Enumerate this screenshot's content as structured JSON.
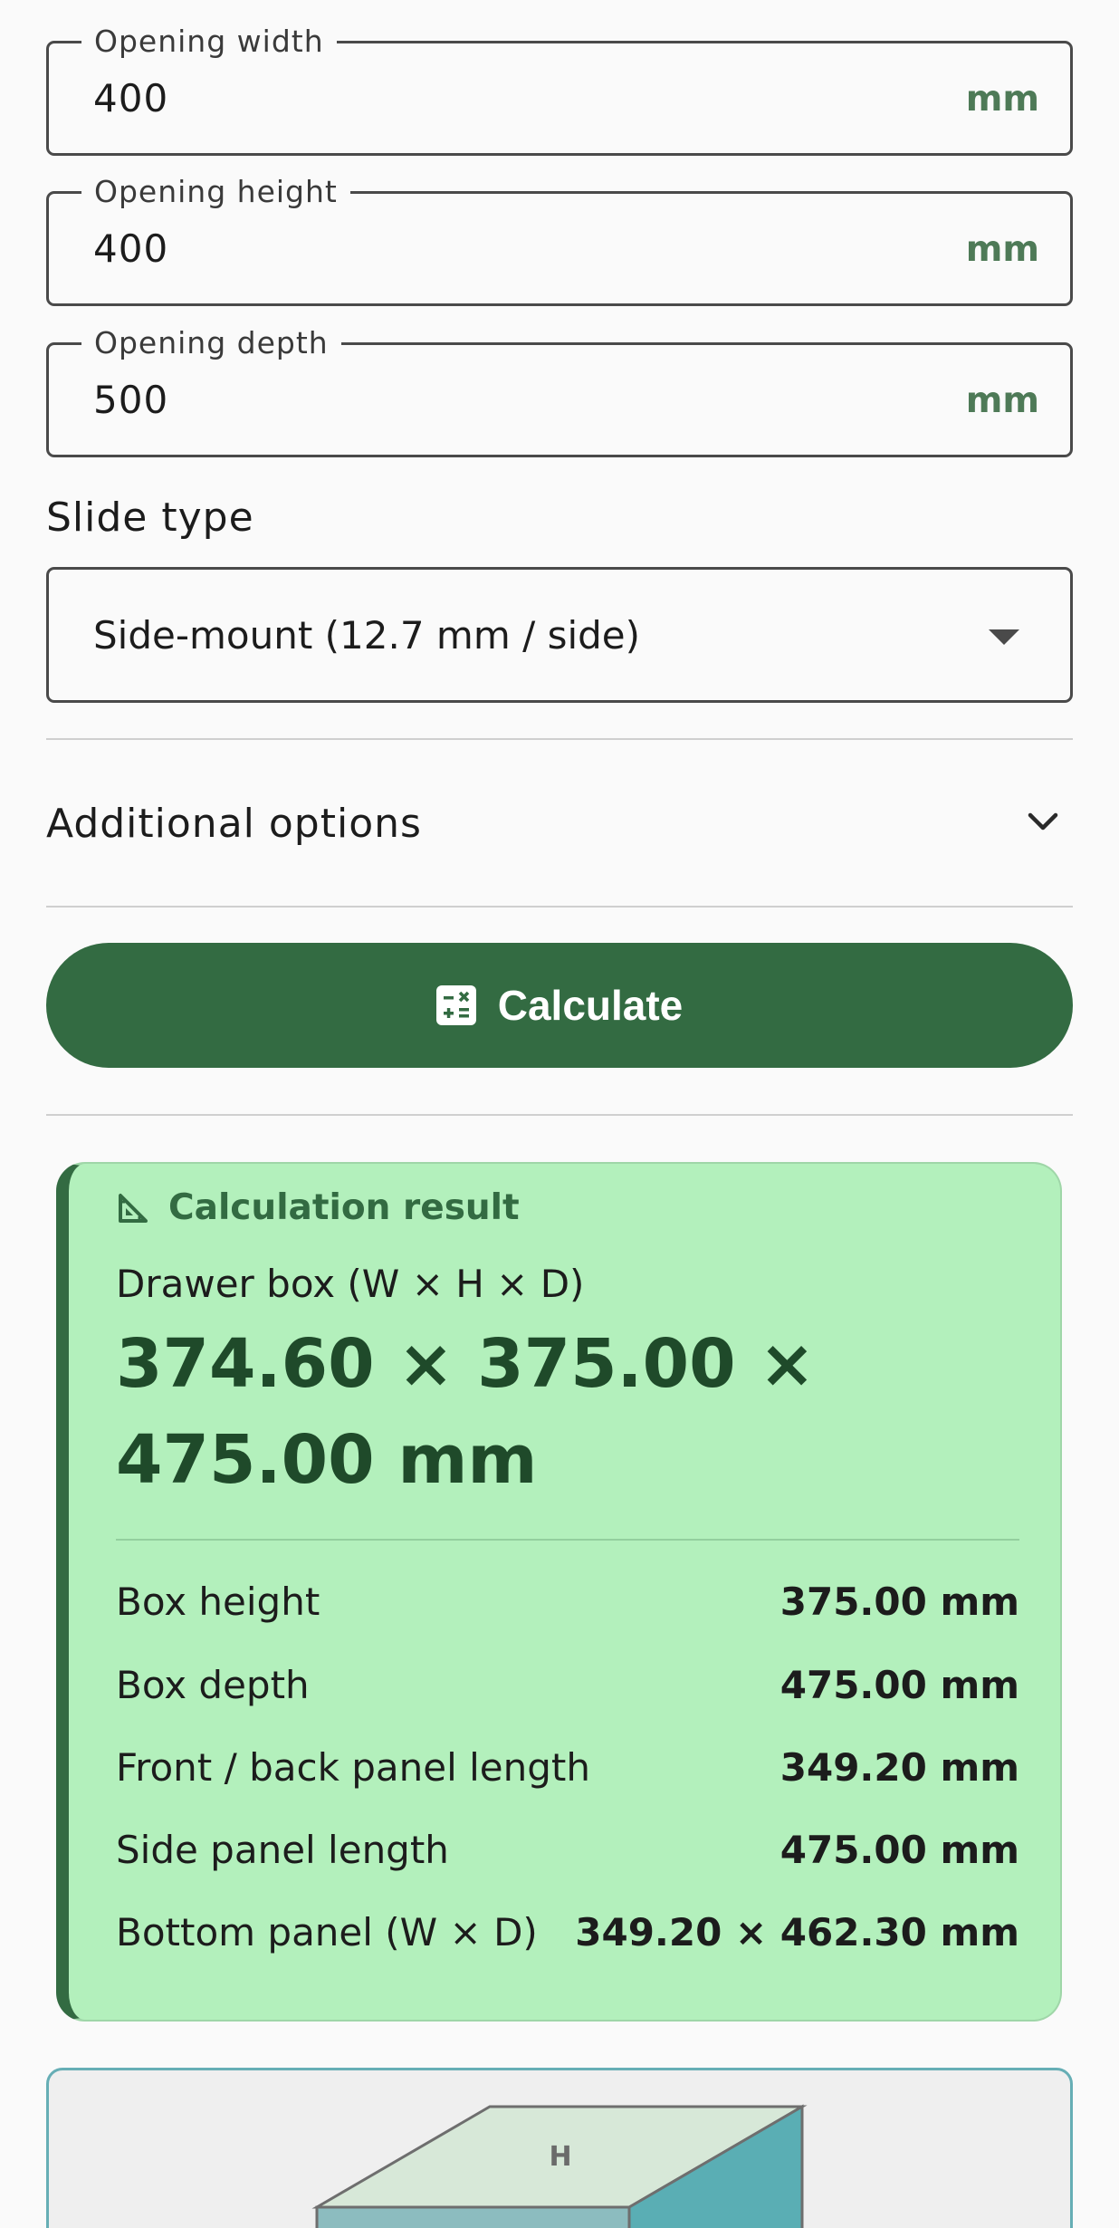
{
  "fields": [
    {
      "label": "Opening width",
      "value": "400",
      "unit": "mm"
    },
    {
      "label": "Opening height",
      "value": "400",
      "unit": "mm"
    },
    {
      "label": "Opening depth",
      "value": "500",
      "unit": "mm"
    }
  ],
  "slide_type": {
    "label": "Slide type",
    "selected": "Side-mount (12.7 mm / side)"
  },
  "additional_options": {
    "label": "Additional options"
  },
  "calculate_button": {
    "label": "Calculate",
    "icon": "calculator-icon"
  },
  "result": {
    "icon": "set-square-icon",
    "title": "Calculation result",
    "subtitle": "Drawer box (W × H × D)",
    "main_value": "374.60 × 375.00 × 475.00 mm",
    "rows": [
      {
        "label": "Box height",
        "value": "375.00 mm"
      },
      {
        "label": "Box depth",
        "value": "475.00 mm"
      },
      {
        "label": "Front / back panel length",
        "value": "349.20 mm"
      },
      {
        "label": "Side panel length",
        "value": "475.00 mm"
      },
      {
        "label": "Bottom panel (W × D)",
        "value": "349.20 × 462.30 mm"
      }
    ]
  },
  "diagram": {
    "top_label": "H"
  },
  "colors": {
    "accent": "#336b42",
    "result_bg": "#b3f0bc",
    "unit": "#4e7a57",
    "diagram_border": "#66aeb5"
  }
}
